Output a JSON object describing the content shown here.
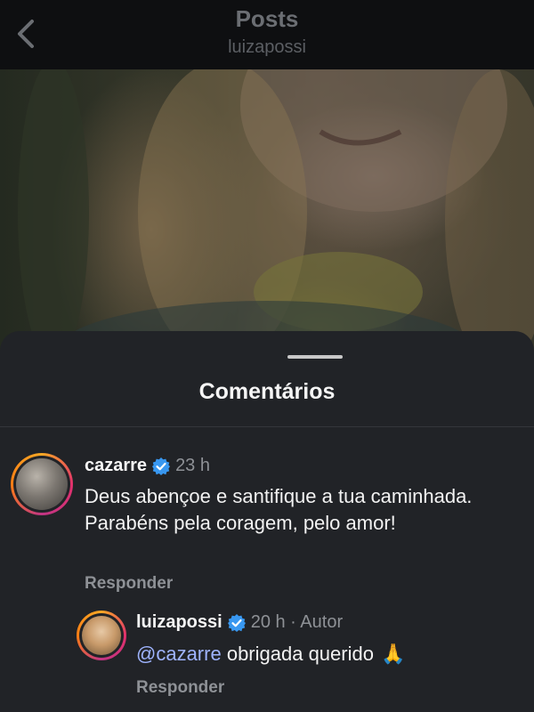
{
  "header": {
    "title": "Posts",
    "subtitle": "luizapossi",
    "back_icon": "chevron-left-icon"
  },
  "sheet": {
    "title": "Comentários"
  },
  "comments": [
    {
      "username": "cazarre",
      "verified": true,
      "time": "23 h",
      "text": "Deus abençoe e santifique a tua caminhada. Parabéns pela coragem, pelo amor!",
      "reply_label": "Responder"
    }
  ],
  "replies": [
    {
      "username": "luizapossi",
      "verified": true,
      "time": "20 h · Autor",
      "mention": "@cazarre",
      "text": "obrigada querido",
      "emoji": "🙏",
      "reply_label": "Responder"
    }
  ],
  "colors": {
    "verified_badge": "#3897f0",
    "mention": "#9fb4ff",
    "sheet_bg": "#212327"
  }
}
